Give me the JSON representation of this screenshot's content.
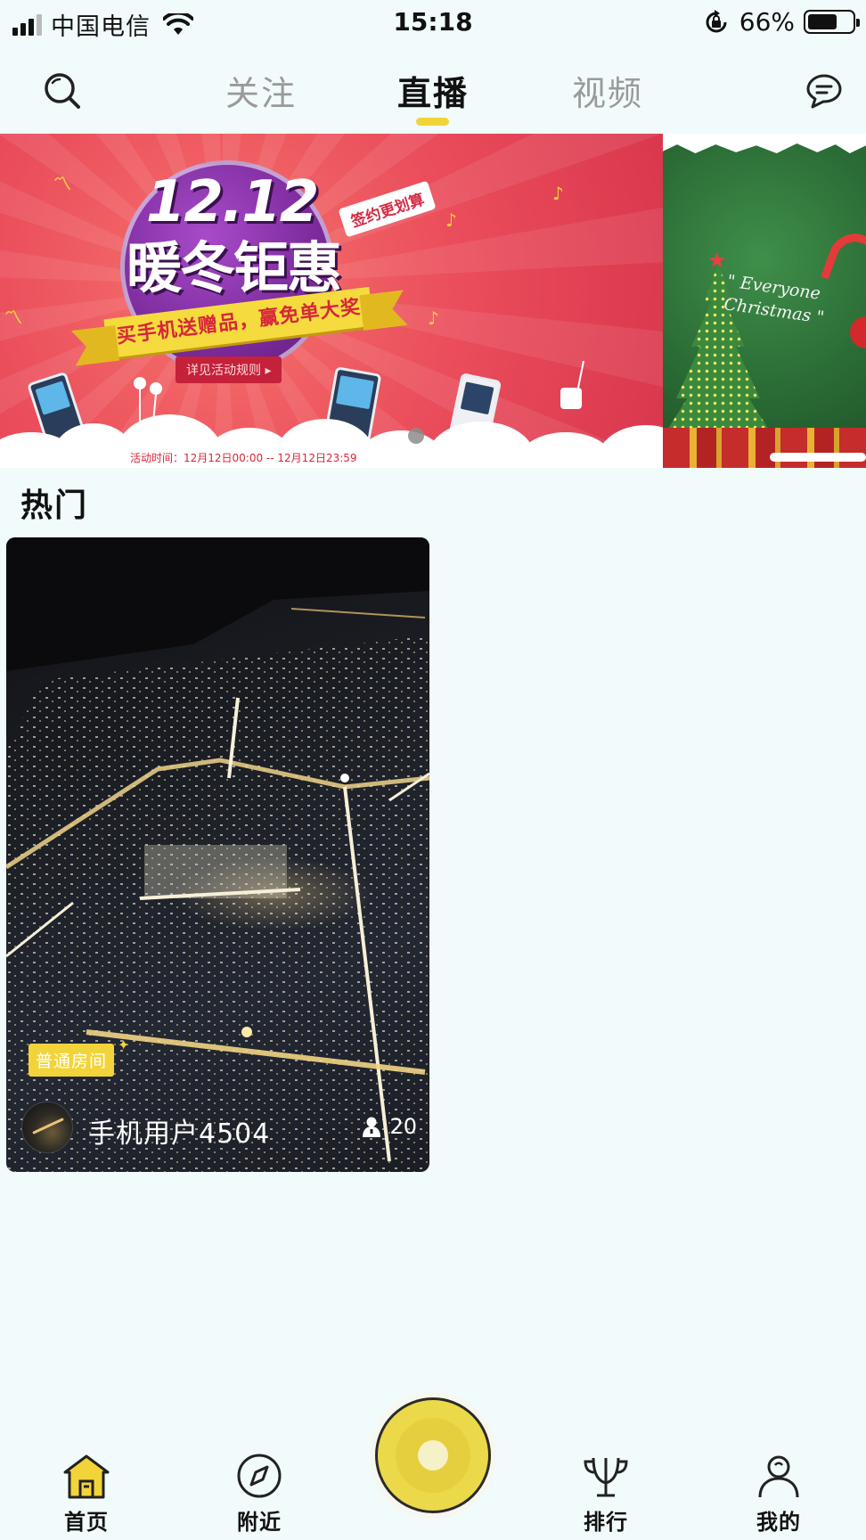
{
  "status_bar": {
    "carrier": "中国电信",
    "time": "15:18",
    "battery_percent": "66%",
    "battery_level": 0.66
  },
  "top_nav": {
    "tabs": [
      {
        "label": "关注",
        "active": false
      },
      {
        "label": "直播",
        "active": true
      },
      {
        "label": "视频",
        "active": false
      }
    ],
    "left_icon": "search-icon",
    "right_icon": "message-icon",
    "accent_color": "#f2d43a"
  },
  "banner": {
    "slides": [
      {
        "headline_number": "12.12",
        "headline": "暖冬钜惠",
        "tag": "签约更划算",
        "ribbon": "买手机送赠品，赢免单大奖",
        "rules_button": "详见活动规则 ▸",
        "event_time": "活动时间：12月12日00:00 -- 12月12日23:59"
      },
      {
        "text_line1": "\" Everyone",
        "text_line2": "Christmas \""
      }
    ],
    "active_index": 0
  },
  "hot_section": {
    "title": "热门",
    "rooms": [
      {
        "room_type": "普通房间",
        "username": "手机用户4504",
        "viewers": "20"
      }
    ]
  },
  "tab_bar": {
    "items": [
      {
        "label": "首页",
        "icon": "home-icon",
        "active": true
      },
      {
        "label": "附近",
        "icon": "compass-icon",
        "active": false
      },
      {
        "label": "排行",
        "icon": "trophy-icon",
        "active": false
      },
      {
        "label": "我的",
        "icon": "profile-icon",
        "active": false
      }
    ],
    "center_button_icon": "live-start-icon",
    "center_color": "#ecd94a"
  }
}
